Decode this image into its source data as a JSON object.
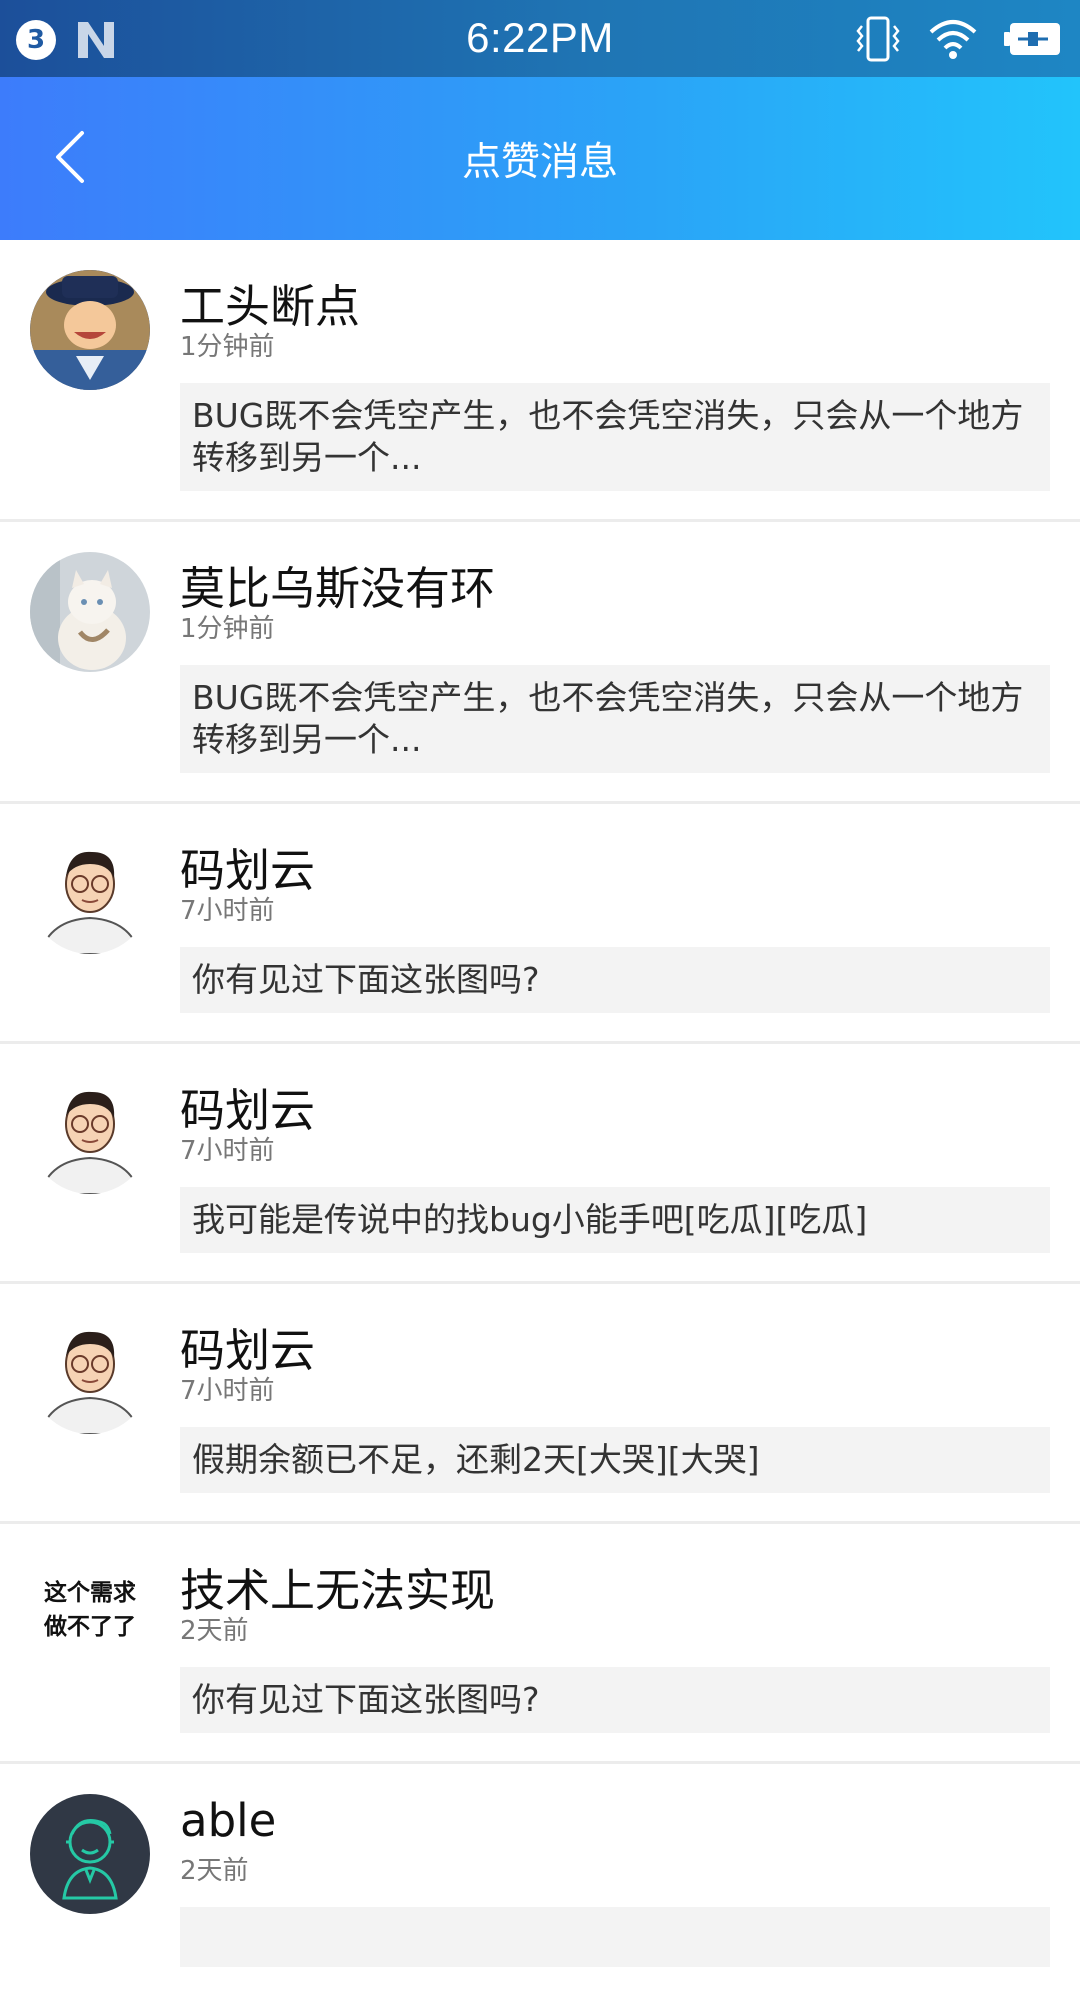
{
  "status_bar": {
    "notification_count": "3",
    "time": "6:22PM",
    "icons": [
      "vibrate-icon",
      "wifi-icon",
      "battery-charging-icon"
    ]
  },
  "header": {
    "title": "点赞消息",
    "back_icon": "chevron-left-icon"
  },
  "colors": {
    "header_gradient_start": "#3d7cfb",
    "header_gradient_end": "#22c4fb",
    "quote_background": "#f3f3f3"
  },
  "messages": [
    {
      "name": "工头断点",
      "time": "1分钟前",
      "text": "BUG既不会凭空产生，也不会凭空消失，只会从一个地方转移到另一个...",
      "avatar": "cartoon-pirate-avatar"
    },
    {
      "name": "莫比乌斯没有环",
      "time": "1分钟前",
      "text": "BUG既不会凭空产生，也不会凭空消失，只会从一个地方转移到另一个...",
      "avatar": "white-cat-avatar"
    },
    {
      "name": "码划云",
      "time": "7小时前",
      "text": "你有见过下面这张图吗?",
      "avatar": "glasses-man-avatar"
    },
    {
      "name": "码划云",
      "time": "7小时前",
      "text": "我可能是传说中的找bug小能手吧[吃瓜][吃瓜]",
      "avatar": "glasses-man-avatar"
    },
    {
      "name": "码划云",
      "time": "7小时前",
      "text": "假期余额已不足，还剩2天[大哭][大哭]",
      "avatar": "glasses-man-avatar"
    },
    {
      "name": "技术上无法实现",
      "time": "2天前",
      "text": "你有见过下面这张图吗?",
      "avatar": "text-avatar",
      "avatar_text_1": "这个需求",
      "avatar_text_2": "做不了了"
    },
    {
      "name": "able",
      "time": "2天前",
      "text": "",
      "avatar": "cartoon-boy-outline-avatar"
    }
  ]
}
